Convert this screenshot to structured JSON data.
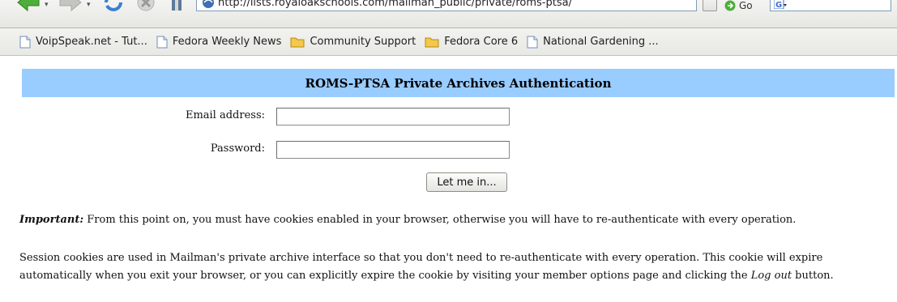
{
  "browser": {
    "url": "http://lists.royaloakschools.com/mailman_public/private/roms-ptsa/",
    "go_label": "Go",
    "bookmarks": [
      {
        "label": "VoipSpeak.net - Tut...",
        "icon": "page-icon"
      },
      {
        "label": "Fedora Weekly News",
        "icon": "page-icon"
      },
      {
        "label": "Community Support",
        "icon": "folder-icon"
      },
      {
        "label": "Fedora Core 6",
        "icon": "folder-icon"
      },
      {
        "label": "National Gardening ...",
        "icon": "page-icon"
      }
    ]
  },
  "page": {
    "title": "ROMS-PTSA Private Archives Authentication",
    "email_label": "Email address:",
    "email_value": "",
    "password_label": "Password:",
    "password_value": "",
    "submit_label": "Let me in...",
    "important_prefix": "Important:",
    "important_text": " From this point on, you must have cookies enabled in your browser, otherwise you will have to re-authenticate with every operation.",
    "session_text_1": "Session cookies are used in Mailman's private archive interface so that you don't need to re-authenticate with every operation. This cookie will expire automatically when you exit your browser, or you can explicitly expire the cookie by visiting your member options page and clicking the ",
    "session_logout": "Log out",
    "session_text_2": " button."
  },
  "colors": {
    "header_band": "#99ccff",
    "folder": "#f3c84b",
    "back_arrow": "#4caf3a"
  }
}
